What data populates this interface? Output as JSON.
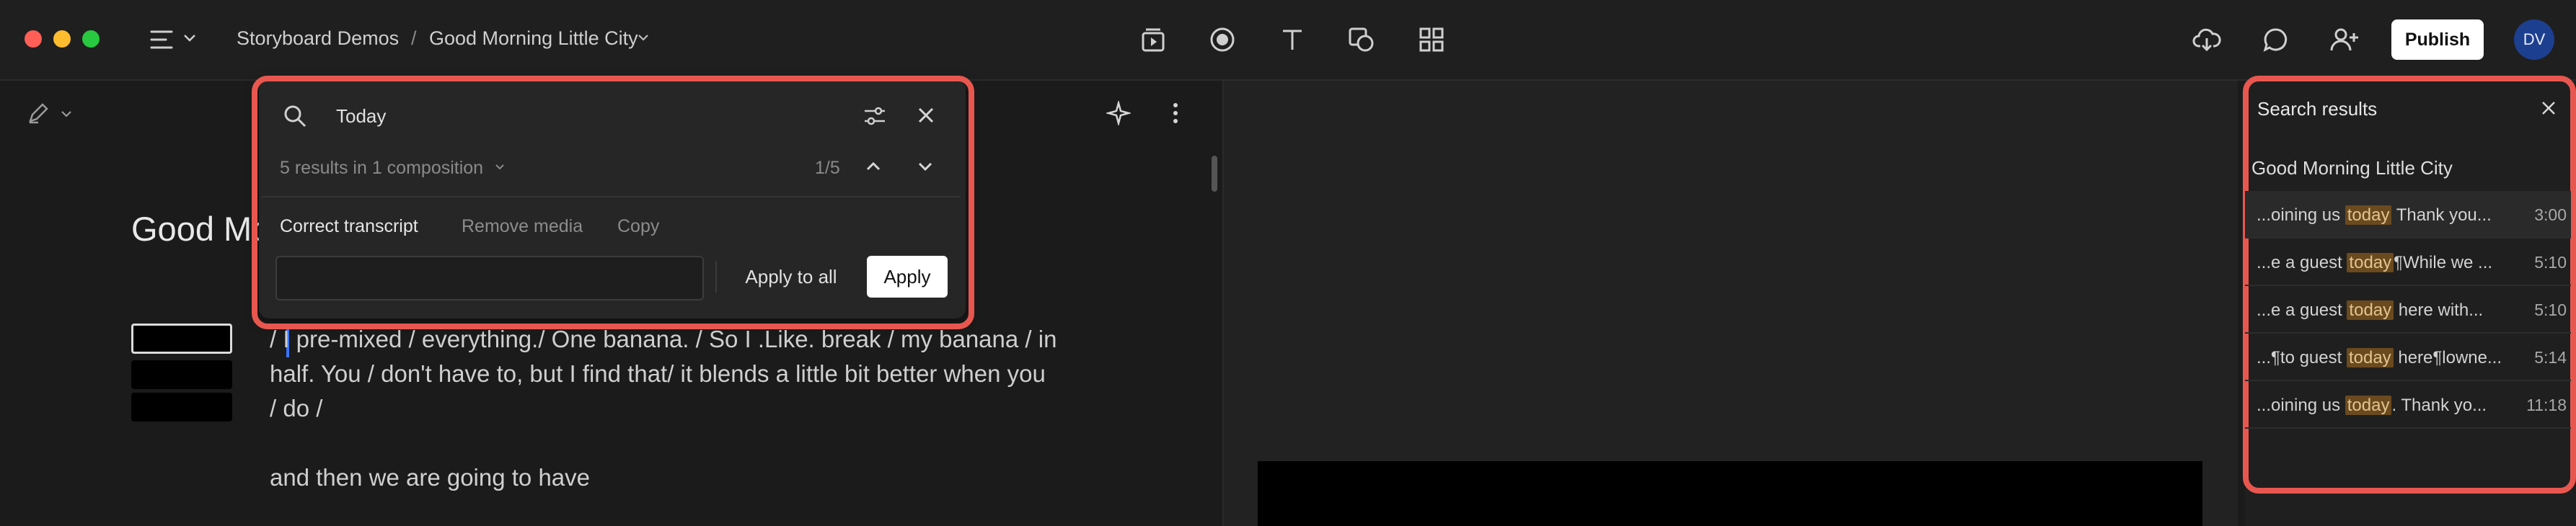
{
  "topbar": {
    "breadcrumb_project": "Storyboard Demos",
    "breadcrumb_sep": "/",
    "breadcrumb_composition": "Good Morning Little City",
    "publish_label": "Publish",
    "avatar_initials": "DV"
  },
  "editor": {
    "title": "Good Mo",
    "transcript": {
      "top_fragment": "/ ...",
      "line1": "/ I pre-mixed / everything./  One banana. / So I .Like. break / my banana / in",
      "line2": "half. You / don't have to, but  I find that/   it blends a little bit better when you",
      "line3": "/ do /",
      "line4": "and then we are going to have"
    }
  },
  "find": {
    "query": "Today",
    "summary": "5 results in 1 composition",
    "counter": "1/5",
    "tabs": [
      "Correct transcript",
      "Remove media",
      "Copy"
    ],
    "apply_all_label": "Apply to all",
    "apply_label": "Apply"
  },
  "search_results": {
    "title": "Search results",
    "group": "Good Morning Little City",
    "items": [
      {
        "before": "...oining us ",
        "match": "today",
        "after": " Thank you...",
        "time": "3:00"
      },
      {
        "before": "...e a guest ",
        "match": "today",
        "after": "¶While we ...",
        "time": "5:10"
      },
      {
        "before": "...e a guest ",
        "match": "today",
        "after": " here with...",
        "time": "5:10"
      },
      {
        "before": "...¶to guest ",
        "match": "today",
        "after": " here¶lowne...",
        "time": "5:14"
      },
      {
        "before": "...oining us ",
        "match": "today",
        "after": ". Thank yo...",
        "time": "11:18"
      }
    ]
  }
}
